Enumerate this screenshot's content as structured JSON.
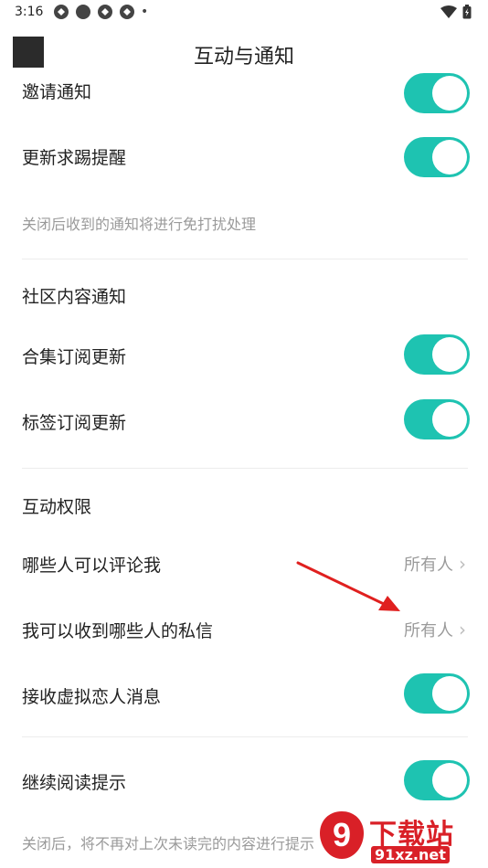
{
  "status_bar": {
    "time": "3:16",
    "dot": "•"
  },
  "header": {
    "title": "互动与通知"
  },
  "rows": {
    "invite": {
      "label": "邀请通知"
    },
    "update_request": {
      "label": "更新求踢提醒"
    },
    "collection_sub": {
      "label": "合集订阅更新"
    },
    "tag_sub": {
      "label": "标签订阅更新"
    },
    "who_comment": {
      "label": "哪些人可以评论我",
      "value": "所有人"
    },
    "who_message": {
      "label": "我可以收到哪些人的私信",
      "value": "所有人"
    },
    "virtual_lover": {
      "label": "接收虚拟恋人消息"
    },
    "continue_reading": {
      "label": "继续阅读提示"
    }
  },
  "hints": {
    "dnd": "关闭后收到的通知将进行免打扰处理",
    "continue": "关闭后，将不再对上次未读完的内容进行提示"
  },
  "sections": {
    "community": "社区内容通知",
    "interaction": "互动权限"
  },
  "watermark": {
    "badge": "9",
    "title": "下载站",
    "sub": "91xz.net"
  },
  "colors": {
    "toggle_on": "#1ec3b1",
    "arrow": "#e0201f",
    "brand_red": "#d92027"
  }
}
